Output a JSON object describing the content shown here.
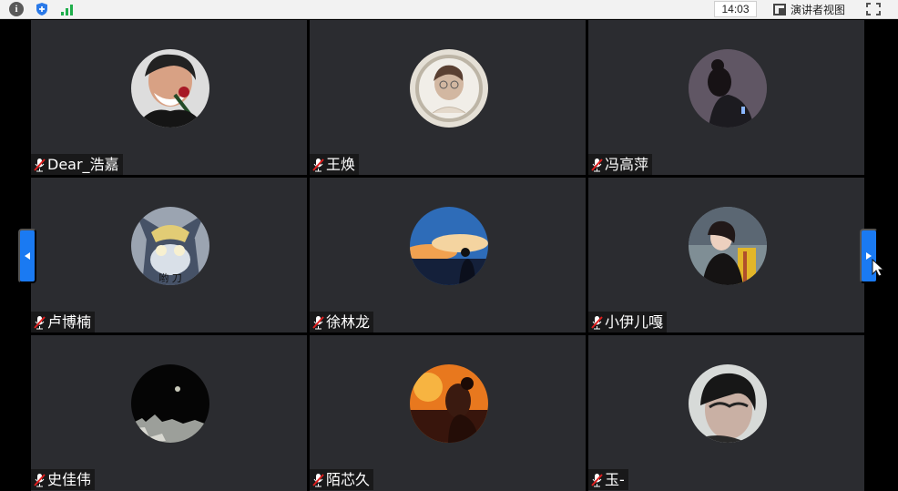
{
  "toolbar": {
    "time": "14:03",
    "presenter_view_label": "演讲者视图",
    "icons": [
      "info-icon",
      "shield-icon",
      "signal-icon",
      "presenter-view-icon",
      "fullscreen-icon"
    ]
  },
  "participants": [
    {
      "name": "Dear_浩嘉",
      "avatar": "man-with-rose"
    },
    {
      "name": "王焕",
      "avatar": "framed-portrait"
    },
    {
      "name": "冯高萍",
      "avatar": "woman-dark-room"
    },
    {
      "name": "卢博楠",
      "avatar": "cartoon-cat"
    },
    {
      "name": "徐林龙",
      "avatar": "sunset-silhouette"
    },
    {
      "name": "小伊儿嘎",
      "avatar": "girl-at-stadium"
    },
    {
      "name": "史佳伟",
      "avatar": "night-moon"
    },
    {
      "name": "陌芯久",
      "avatar": "orange-sunset-profile"
    },
    {
      "name": "玉-",
      "avatar": "dark-haired-boy"
    }
  ],
  "avatar_text": {
    "cartoon-cat": "哟 刀"
  },
  "navigation": {
    "previous_icon": "chevron-left-icon",
    "next_icon": "chevron-right-icon"
  },
  "bottom_progress": 0.34,
  "colors": {
    "tile_background": "#2b2c30",
    "nav_button": "#1a7af2",
    "top_bar": "#f2f2f2"
  }
}
